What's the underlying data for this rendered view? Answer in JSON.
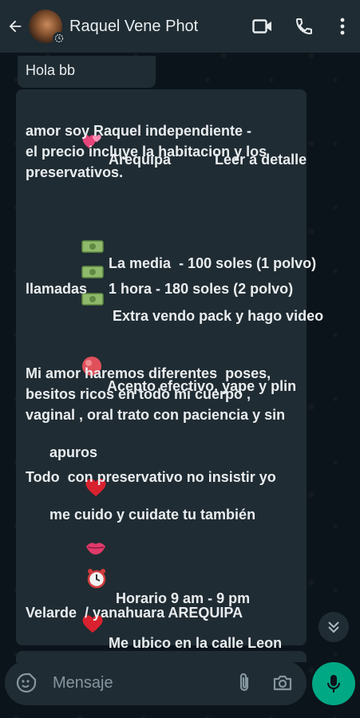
{
  "header": {
    "contact_name": "Raquel Vene Phot"
  },
  "messages": {
    "greeting": "Hola bb",
    "lines": [
      "Arequipa           Leer a detalle",
      "amor soy Raquel independiente -",
      "el precio incluye la habitacion y los",
      "preservativos.",
      "La media  - 100 soles (1 polvo)",
      "1 hora - 180 soles (2 polvo)",
      " Extra vendo pack y hago video",
      "llamadas",
      "Acepto efectivo, yape y plin",
      "Mi amor haremos diferentes  poses,",
      "besitos ricos en todo mi cuerpo ,",
      "vaginal , oral trato con paciencia y sin",
      "apuros",
      "Todo  con preservativo no insistir yo",
      "me cuido y cuidate tu también",
      " Horario 9 am - 9 pm",
      "Me ubico en la calle Leon",
      "Velarde  / yanahuara AREQUIPA"
    ]
  },
  "input": {
    "placeholder": "Mensaje"
  },
  "icons": {
    "back": "arrow-back-icon",
    "video": "video-call-icon",
    "phone": "phone-icon",
    "menu": "more-vert-icon",
    "emoji": "sticker-icon",
    "attach": "paperclip-icon",
    "camera": "camera-icon",
    "mic": "microphone-icon",
    "scroll": "chevrons-down-icon"
  },
  "colors": {
    "header_bg": "#1f2c33",
    "bubble_bg": "#202c33",
    "chat_bg": "#0b141a",
    "accent_green": "#00a884"
  }
}
